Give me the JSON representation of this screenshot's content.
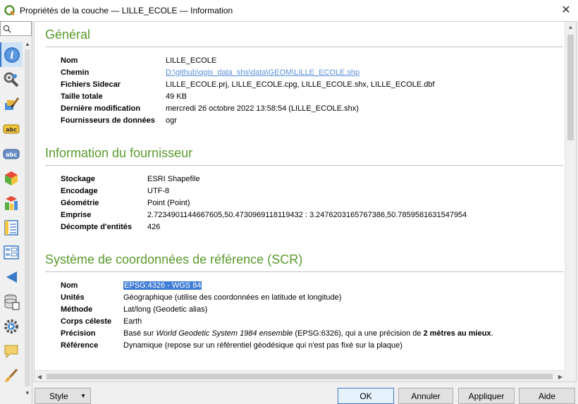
{
  "window": {
    "title": "Propriétés de la couche — LILLE_ECOLE — Information"
  },
  "search": {
    "placeholder": "",
    "value": ""
  },
  "sidebar": {
    "items": [
      {
        "name": "information-icon",
        "label": "Information",
        "active": true
      },
      {
        "name": "source-icon",
        "label": "Source"
      },
      {
        "name": "symbology-icon",
        "label": "Symbologie"
      },
      {
        "name": "labels-icon",
        "label": "Étiquettes"
      },
      {
        "name": "masks-icon",
        "label": "Masques"
      },
      {
        "name": "3d-view-icon",
        "label": "Vue 3D"
      },
      {
        "name": "diagrams-icon",
        "label": "Diagrammes"
      },
      {
        "name": "fields-icon",
        "label": "Champs"
      },
      {
        "name": "attributes-form-icon",
        "label": "Formulaire d'attributs"
      },
      {
        "name": "joins-icon",
        "label": "Jointures"
      },
      {
        "name": "auxiliary-storage-icon",
        "label": "Stockage auxiliaire"
      },
      {
        "name": "actions-icon",
        "label": "Actions"
      },
      {
        "name": "display-icon",
        "label": "Infobulles"
      },
      {
        "name": "rendering-icon",
        "label": "Rendu"
      }
    ]
  },
  "general": {
    "title": "Général",
    "rows": [
      {
        "key": "Nom",
        "value": "LILLE_ECOLE"
      },
      {
        "key": "Chemin",
        "value": "D:\\github\\qgis_data_shs\\data\\GEOM\\LILLE_ECOLE.shp",
        "link": true
      },
      {
        "key": "Fichiers Sidecar",
        "value": "LILLE_ECOLE.prj, LILLE_ECOLE.cpg, LILLE_ECOLE.shx, LILLE_ECOLE.dbf"
      },
      {
        "key": "Taille totale",
        "value": "49 KB"
      },
      {
        "key": "Dernière modification",
        "value": "mercredi 26 octobre 2022 13:58:54 (LILLE_ECOLE.shx)"
      },
      {
        "key": "Fournisseurs de données",
        "value": "ogr"
      }
    ]
  },
  "provider": {
    "title": "Information du fournisseur",
    "rows": [
      {
        "key": "Stockage",
        "value": "ESRI Shapefile"
      },
      {
        "key": "Encodage",
        "value": "UTF-8"
      },
      {
        "key": "Géométrie",
        "value": "Point (Point)"
      },
      {
        "key": "Emprise",
        "value": "2.7234901144667605,50.4730969118119432 : 3.2476203165767386,50.7859581631547954"
      },
      {
        "key": "Décompte d'entités",
        "value": "426"
      }
    ]
  },
  "crs": {
    "title": "Système de coordonnées de référence (SCR)",
    "rows": [
      {
        "key": "Nom",
        "value": "EPSG:4326 - WGS 84",
        "selected": true
      },
      {
        "key": "Unités",
        "value": "Géographique (utilise des coordonnées en latitude et longitude)"
      },
      {
        "key": "Méthode",
        "value": "Lat/long (Geodetic alias)"
      },
      {
        "key": "Corps céleste",
        "value": "Earth"
      },
      {
        "key": "Précision",
        "prefix": "Basé sur ",
        "italic": "World Geodetic System 1984 ensemble",
        "mid": " (EPSG:6326), qui a une précision de ",
        "bold": "2 mètres au mieux",
        "suffix": "."
      },
      {
        "key": "Référence",
        "value": "Dynamique (repose sur un référentiel géodésique qui n'est pas fixé sur la plaque)"
      }
    ]
  },
  "buttons": {
    "style": "Style",
    "ok": "OK",
    "cancel": "Annuler",
    "apply": "Appliquer",
    "help": "Aide"
  },
  "colors": {
    "section_title": "#5a9a2c",
    "selection": "#3e7cd6",
    "link": "#5a8fd8"
  }
}
